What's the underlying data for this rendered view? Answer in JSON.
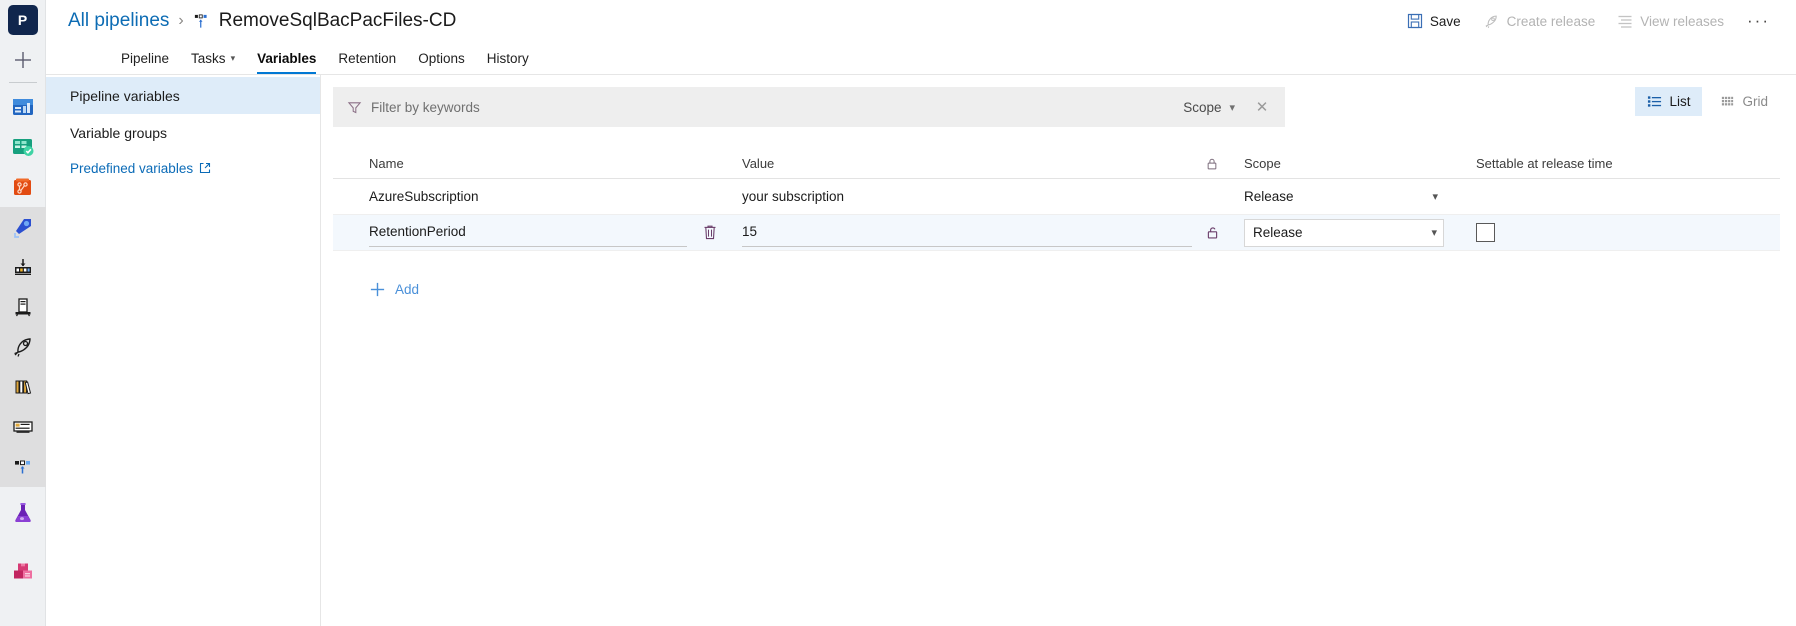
{
  "rail": {
    "logo_label": "P",
    "new_icon": "plus-icon",
    "items": [
      {
        "name": "overview-icon",
        "label": "Overview"
      },
      {
        "name": "boards-icon",
        "label": "Boards"
      },
      {
        "name": "repos-icon",
        "label": "Repos"
      },
      {
        "name": "pipelines-icon",
        "label": "Pipelines"
      },
      {
        "name": "builds-icon",
        "label": "Builds"
      },
      {
        "name": "releases-icon",
        "label": "Releases"
      },
      {
        "name": "rocket-icon",
        "label": "Deployment groups"
      },
      {
        "name": "library-icon",
        "label": "Library"
      },
      {
        "name": "task-groups-icon",
        "label": "Task groups"
      },
      {
        "name": "deployment-groups-icon",
        "label": "Deployment groups"
      },
      {
        "name": "test-plans-icon",
        "label": "Test Plans"
      },
      {
        "name": "artifacts-icon",
        "label": "Artifacts"
      }
    ]
  },
  "header": {
    "breadcrumb_link": "All pipelines",
    "breadcrumb_separator": "›",
    "pipeline_icon": "release-pipeline-icon",
    "title": "RemoveSqlBacPacFiles-CD",
    "actions": [
      {
        "label": "Save",
        "icon": "save-icon",
        "disabled": false
      },
      {
        "label": "Create release",
        "icon": "rocket-icon",
        "disabled": true
      },
      {
        "label": "View releases",
        "icon": "list-lines-icon",
        "disabled": true
      }
    ],
    "more_label": "···"
  },
  "tabs": [
    {
      "label": "Pipeline",
      "active": false,
      "caret": false
    },
    {
      "label": "Tasks",
      "active": false,
      "caret": true
    },
    {
      "label": "Variables",
      "active": true,
      "caret": false
    },
    {
      "label": "Retention",
      "active": false,
      "caret": false
    },
    {
      "label": "Options",
      "active": false,
      "caret": false
    },
    {
      "label": "History",
      "active": false,
      "caret": false
    }
  ],
  "leftnav": {
    "items": [
      {
        "label": "Pipeline variables",
        "selected": true
      },
      {
        "label": "Variable groups",
        "selected": false
      }
    ],
    "external_link": {
      "label": "Predefined variables",
      "icon": "external-link-icon"
    }
  },
  "filter": {
    "icon": "filter-icon",
    "placeholder": "Filter by keywords",
    "scope_label": "Scope",
    "scope_caret": "⌄",
    "clear_label": "✕"
  },
  "view_toggle": {
    "list": {
      "label": "List",
      "icon": "list-view-icon",
      "active": true
    },
    "grid": {
      "label": "Grid",
      "icon": "grid-view-icon",
      "active": false
    }
  },
  "table": {
    "headers": {
      "name": "Name",
      "value": "Value",
      "lock": "lock-icon",
      "scope": "Scope",
      "settable": "Settable at release time"
    },
    "rows": [
      {
        "name": "AzureSubscription",
        "value": "your subscription",
        "scope": "Release",
        "scope_caret": "⌄",
        "selected": false,
        "show_delete": false,
        "show_lock": false,
        "show_checkbox": false
      },
      {
        "name": "RetentionPeriod",
        "value": "15",
        "scope": "Release",
        "scope_caret": "⌄",
        "selected": true,
        "show_delete": true,
        "show_lock": true,
        "show_checkbox": true,
        "delete_icon": "trash-icon",
        "lock_icon": "unlock-icon"
      }
    ],
    "add_label": "Add",
    "add_icon": "plus-icon"
  },
  "colors": {
    "accent": "#0078d4",
    "link": "#0d6cb4",
    "selected_row": "#f3f8fd",
    "selected_nav": "#deecf9",
    "filter_bg": "#eeeeee",
    "rail_bg": "#eff1f3"
  }
}
